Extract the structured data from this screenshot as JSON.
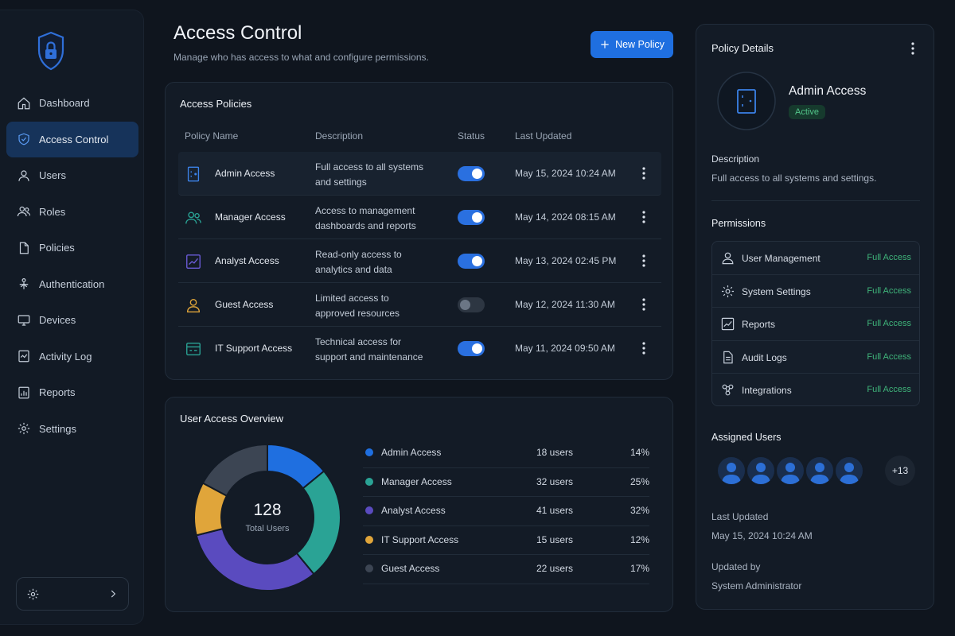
{
  "nav": {
    "items": [
      {
        "label": "Dashboard",
        "icon": "home-icon"
      },
      {
        "label": "Access Control",
        "icon": "shield-check-icon",
        "active": true
      },
      {
        "label": "Users",
        "icon": "user-icon"
      },
      {
        "label": "Roles",
        "icon": "users-icon"
      },
      {
        "label": "Policies",
        "icon": "document-icon"
      },
      {
        "label": "Authentication",
        "icon": "fingerprint-icon"
      },
      {
        "label": "Devices",
        "icon": "monitor-icon"
      },
      {
        "label": "Activity Log",
        "icon": "activity-icon"
      },
      {
        "label": "Reports",
        "icon": "report-icon"
      },
      {
        "label": "Settings",
        "icon": "gear-icon"
      }
    ]
  },
  "header": {
    "title": "Access Control",
    "subtitle": "Manage who has access to what and configure permissions.",
    "new_policy_label": "New Policy"
  },
  "policies": {
    "title": "Access Policies",
    "columns": [
      "Policy Name",
      "Description",
      "Status",
      "Last Updated"
    ],
    "rows": [
      {
        "name": "Admin Access",
        "desc_line1": "Full access to all systems",
        "desc_line2": "and settings",
        "enabled": true,
        "updated": "May 15, 2024 10:24 AM",
        "selected": true
      },
      {
        "name": "Manager Access",
        "desc_line1": "Access to management",
        "desc_line2": "dashboards and reports",
        "enabled": true,
        "updated": "May 14, 2024 08:15 AM"
      },
      {
        "name": "Analyst Access",
        "desc_line1": "Read-only access to",
        "desc_line2": "analytics and data",
        "enabled": true,
        "updated": "May 13, 2024 02:45 PM"
      },
      {
        "name": "Guest Access",
        "desc_line1": "Limited access to",
        "desc_line2": "approved resources",
        "enabled": false,
        "updated": "May 12, 2024 11:30 AM"
      },
      {
        "name": "IT Support Access",
        "desc_line1": "Technical access for",
        "desc_line2": "support and maintenance",
        "enabled": true,
        "updated": "May 11, 2024 09:50 AM"
      }
    ]
  },
  "overview": {
    "title": "User Access Overview",
    "total": "128",
    "total_label": "Total Users"
  },
  "chart_data": {
    "type": "pie",
    "categories": [
      "Admin Access",
      "Manager Access",
      "Analyst Access",
      "IT Support Access",
      "Guest Access"
    ],
    "values": [
      18,
      32,
      41,
      15,
      22
    ],
    "users_text": [
      "18 users",
      "32 users",
      "41 users",
      "15 users",
      "22 users"
    ],
    "percent_text": [
      "14%",
      "25%",
      "32%",
      "12%",
      "17%"
    ],
    "colors": [
      "#1f6fe0",
      "#2aa395",
      "#5a4bbf",
      "#e0a53a",
      "#3c4553"
    ]
  },
  "details": {
    "title": "Policy Details",
    "policy_name": "Admin Access",
    "status": "Active",
    "description_label": "Description",
    "description": "Full access to all systems and settings.",
    "permissions_label": "Permissions",
    "permissions": [
      {
        "name": "User Management",
        "level": "Full Access",
        "icon": "user-icon"
      },
      {
        "name": "System Settings",
        "level": "Full Access",
        "icon": "gear-icon"
      },
      {
        "name": "Reports",
        "level": "Full Access",
        "icon": "chart-icon"
      },
      {
        "name": "Audit Logs",
        "level": "Full Access",
        "icon": "document-icon"
      },
      {
        "name": "Integrations",
        "level": "Full Access",
        "icon": "integration-icon"
      }
    ],
    "assigned_label": "Assigned Users",
    "more_users": "+13",
    "last_updated_label": "Last Updated",
    "last_updated": "May 15, 2024 10:24 AM",
    "updated_by_label": "Updated by",
    "updated_by": "System Administrator"
  },
  "colors": {
    "accent": "#1f6fe0",
    "active_nav": "#16335a",
    "success": "#3fb47a"
  }
}
